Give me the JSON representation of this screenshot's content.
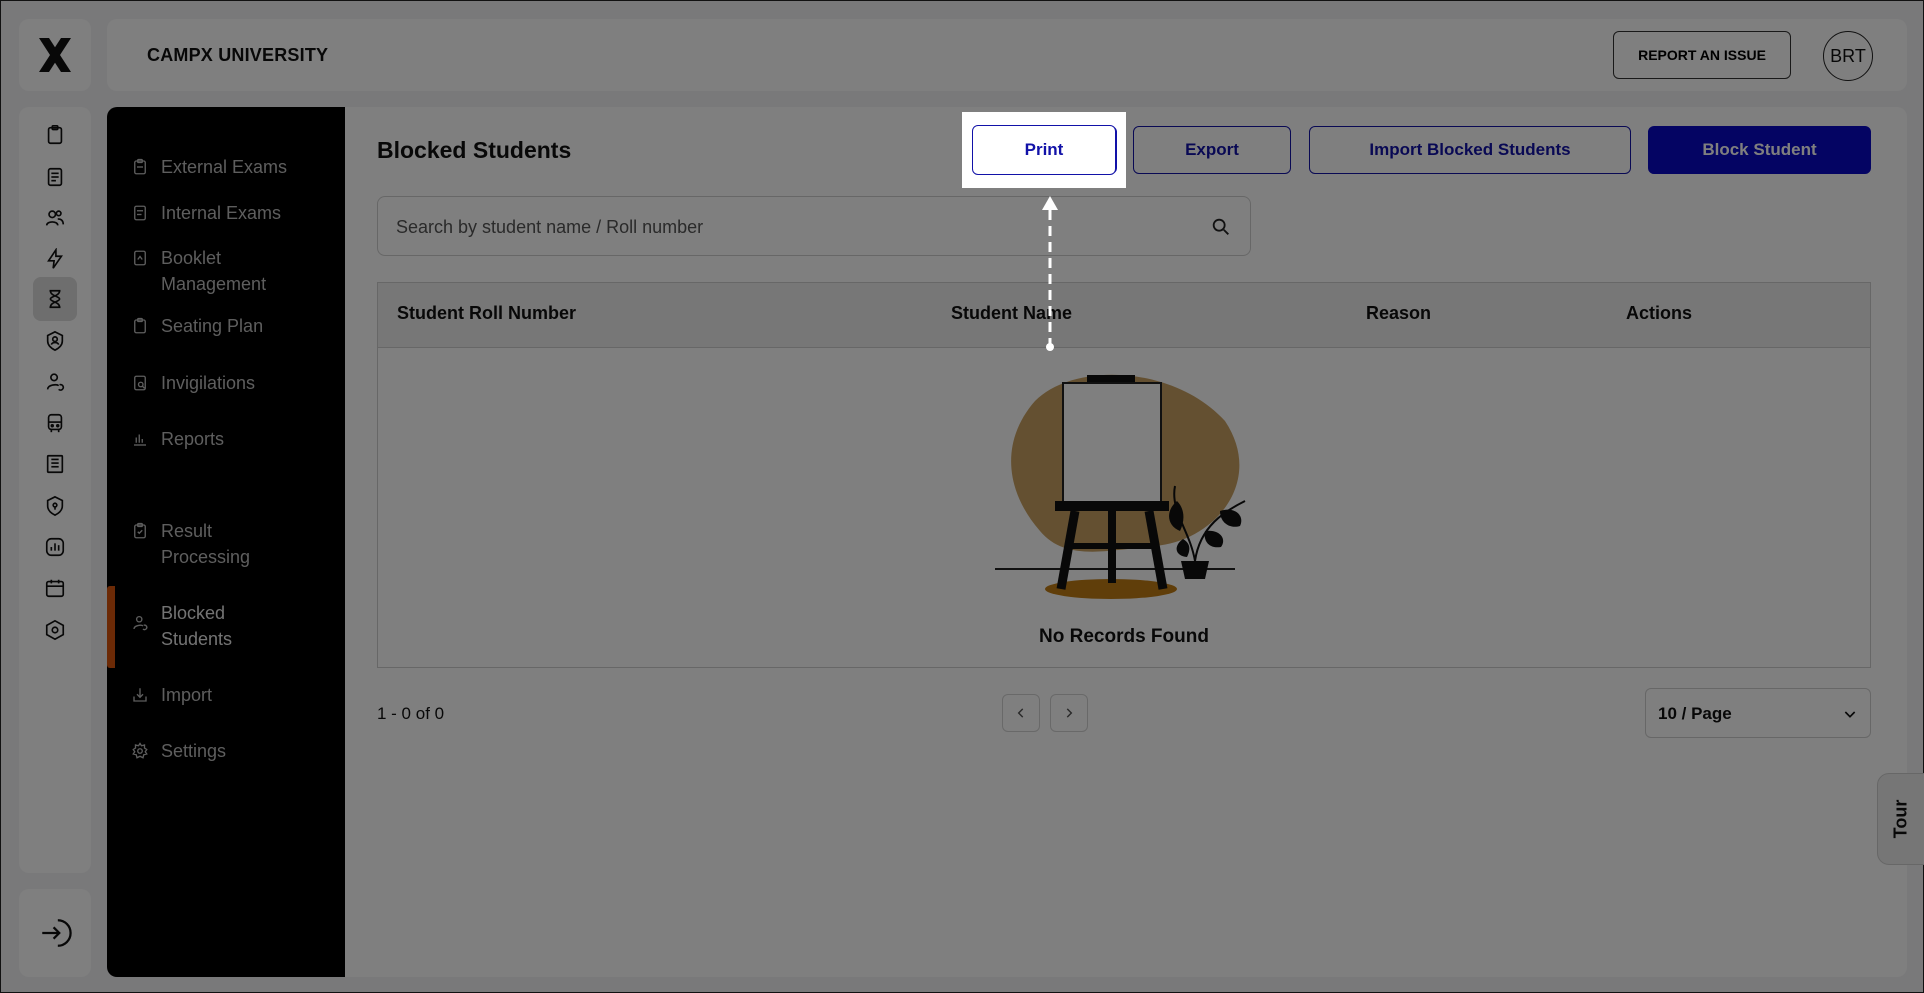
{
  "header": {
    "university_name": "CAMPX UNIVERSITY",
    "report_button": "REPORT AN ISSUE",
    "avatar_initials": "BRT"
  },
  "rail": {
    "icons": [
      "clipboard-icon",
      "notebook-icon",
      "people-icon",
      "bolt-icon",
      "hourglass-icon",
      "shield-person-icon",
      "person-refresh-icon",
      "bus-icon",
      "ledger-icon",
      "shield-lock-icon",
      "chart-icon",
      "calendar-icon",
      "hexagon-settings-icon"
    ],
    "active_index": 4,
    "logout_icon": "logout-icon"
  },
  "sidebar": {
    "items": [
      {
        "label": "External Exams",
        "icon": "exam-icon"
      },
      {
        "label": "Internal Exams",
        "icon": "exam-icon"
      },
      {
        "label": "Booklet Management",
        "icon": "booklet-icon"
      },
      {
        "label": "Seating Plan",
        "icon": "seating-icon"
      },
      {
        "label": "Invigilations",
        "icon": "invigilation-icon"
      },
      {
        "label": "Reports",
        "icon": "reports-icon"
      },
      {
        "label": "Result Processing",
        "icon": "result-icon"
      },
      {
        "label": "Blocked Students",
        "icon": "blocked-icon"
      },
      {
        "label": "Import",
        "icon": "import-icon"
      },
      {
        "label": "Settings",
        "icon": "settings-icon"
      }
    ],
    "active_label": "Blocked Students",
    "accent_color": "#d8550c"
  },
  "main": {
    "title": "Blocked Students",
    "buttons": {
      "print": "Print",
      "export": "Export",
      "import": "Import Blocked Students",
      "block": "Block Student"
    },
    "search_placeholder": "Search by student name / Roll number",
    "table": {
      "columns": [
        "Student Roll Number",
        "Student Name",
        "Reason",
        "Actions"
      ],
      "rows": [],
      "empty_text": "No Records Found"
    },
    "pagination": {
      "summary": "1 - 0 of 0",
      "page_size": "10 / Page"
    }
  },
  "tour_label": "Tour",
  "colors": {
    "primary": "#0909c7",
    "dim_overlay": "rgba(0,0,0,0.5)"
  }
}
